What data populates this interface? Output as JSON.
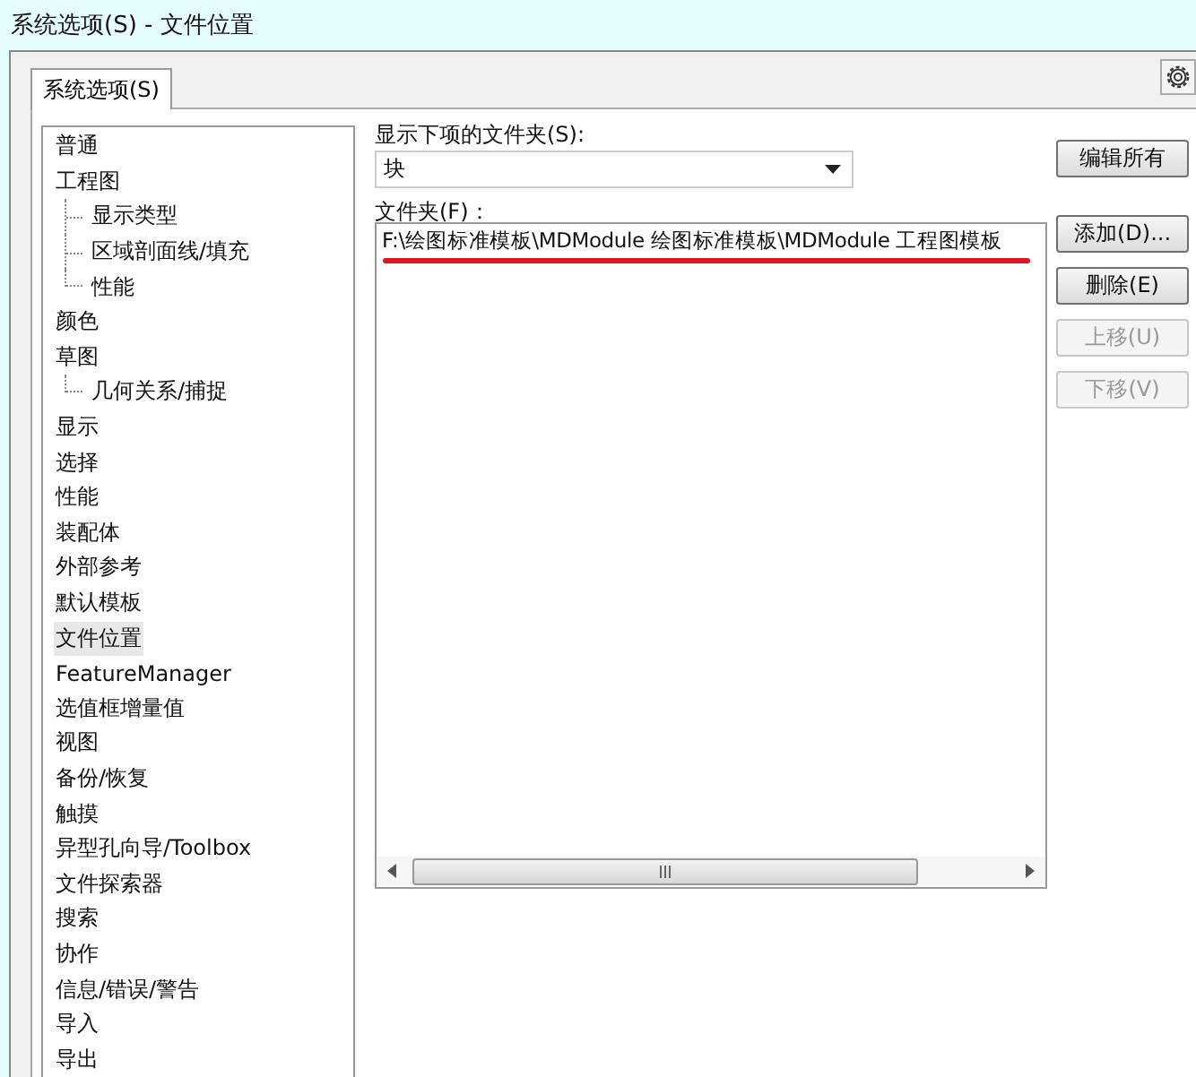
{
  "window": {
    "title": "系统选项(S) - 文件位置"
  },
  "tabs": [
    {
      "label": "系统选项(S)",
      "selected": true
    }
  ],
  "sidebar": {
    "items": [
      {
        "label": "普通",
        "selected": false
      },
      {
        "label": "工程图",
        "selected": false,
        "children": [
          {
            "label": "显示类型",
            "selected": false
          },
          {
            "label": "区域剖面线/填充",
            "selected": false
          },
          {
            "label": "性能",
            "selected": false
          }
        ]
      },
      {
        "label": "颜色",
        "selected": false
      },
      {
        "label": "草图",
        "selected": false,
        "children": [
          {
            "label": "几何关系/捕捉",
            "selected": false
          }
        ]
      },
      {
        "label": "显示",
        "selected": false
      },
      {
        "label": "选择",
        "selected": false
      },
      {
        "label": "性能",
        "selected": false
      },
      {
        "label": "装配体",
        "selected": false
      },
      {
        "label": "外部参考",
        "selected": false
      },
      {
        "label": "默认模板",
        "selected": false
      },
      {
        "label": "文件位置",
        "selected": true
      },
      {
        "label": "FeatureManager",
        "selected": false
      },
      {
        "label": "选值框增量值",
        "selected": false
      },
      {
        "label": "视图",
        "selected": false
      },
      {
        "label": "备份/恢复",
        "selected": false
      },
      {
        "label": "触摸",
        "selected": false
      },
      {
        "label": "异型孔向导/Toolbox",
        "selected": false
      },
      {
        "label": "文件探索器",
        "selected": false
      },
      {
        "label": "搜索",
        "selected": false
      },
      {
        "label": "协作",
        "selected": false
      },
      {
        "label": "信息/错误/警告",
        "selected": false
      },
      {
        "label": "导入",
        "selected": false
      },
      {
        "label": "导出",
        "selected": false
      }
    ]
  },
  "show_folders_for": {
    "label": "显示下项的文件夹(S):",
    "value": "块"
  },
  "folders": {
    "label": "文件夹(F)：",
    "items": [
      {
        "path": "F:\\绘图标准模板\\MDModule 绘图标准模板\\MDModule 工程图模板",
        "underlined": true
      }
    ]
  },
  "buttons": [
    {
      "label": "编辑所有",
      "disabled": false
    },
    {
      "label": "添加(D)...",
      "disabled": false
    },
    {
      "label": "删除(E)",
      "disabled": false
    },
    {
      "label": "上移(U)",
      "disabled": true
    },
    {
      "label": "下移(V)",
      "disabled": true
    }
  ]
}
